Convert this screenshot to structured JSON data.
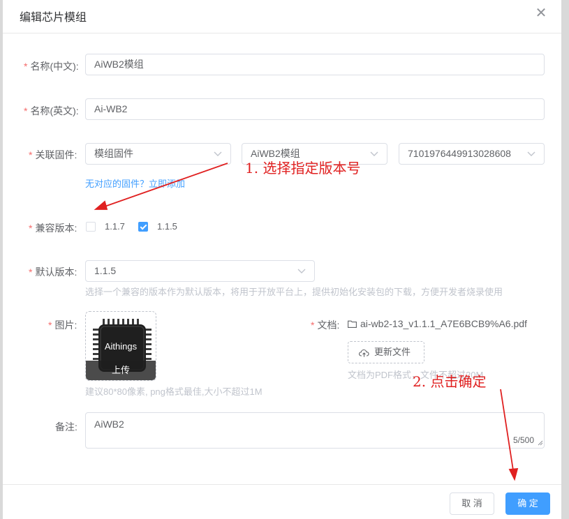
{
  "dialog": {
    "title": "编辑芯片模组",
    "close_icon": "close-icon"
  },
  "form": {
    "name_cn": {
      "label": "名称(中文):",
      "value": "AiWB2模组"
    },
    "name_en": {
      "label": "名称(英文):",
      "value": "Ai-WB2"
    },
    "firmware": {
      "label": "关联固件:",
      "select1": "模组固件",
      "select2": "AiWB2模组",
      "select3": "7101976449913028608",
      "link": "无对应的固件？立即添加"
    },
    "compat": {
      "label": "兼容版本:",
      "options": [
        {
          "label": "1.1.7",
          "checked": false
        },
        {
          "label": "1.1.5",
          "checked": true
        }
      ]
    },
    "default_version": {
      "label": "默认版本:",
      "value": "1.1.5",
      "hint": "选择一个兼容的版本作为默认版本，将用于开放平台上，提供初始化安装包的下载，方便开发者烧录使用"
    },
    "image": {
      "label": "图片:",
      "chip_text": "Aithings",
      "upload_label": "上传",
      "hint": "建议80*80像素, png格式最佳,大小不超过1M"
    },
    "doc": {
      "label": "文档:",
      "filename": "ai-wb2-13_v1.1.1_A7E6BCB9%A6.pdf",
      "update_button": "更新文件",
      "hint": "文档为PDF格式，文件不超过20M"
    },
    "remark": {
      "label": "备注:",
      "value": "AiWB2",
      "counter": "5/500"
    }
  },
  "footer": {
    "cancel": "取 消",
    "confirm": "确 定"
  },
  "annotations": {
    "step1": "1. 选择指定版本号",
    "step2": "2. 点击确定",
    "color": "#e02020"
  },
  "colors": {
    "primary": "#409eff",
    "required": "#f56c6c"
  }
}
